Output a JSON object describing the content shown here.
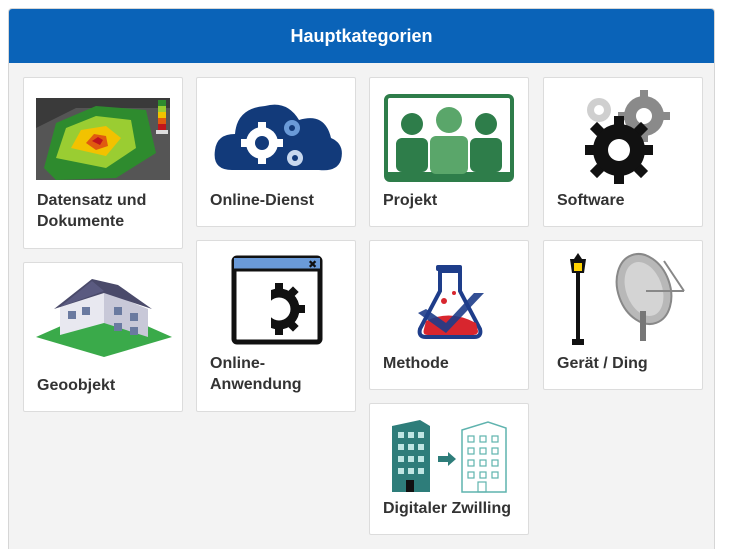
{
  "header": {
    "title": "Hauptkategorien"
  },
  "categories": [
    {
      "label": "Datensatz und Dokumente",
      "icon": "dataset-map-icon"
    },
    {
      "label": "Online-Dienst",
      "icon": "cloud-gears-icon"
    },
    {
      "label": "Projekt",
      "icon": "team-board-icon"
    },
    {
      "label": "Software",
      "icon": "gears-icon"
    },
    {
      "label": "Geoobjekt",
      "icon": "house-icon"
    },
    {
      "label": "Online-Anwendung",
      "icon": "app-window-gear-icon"
    },
    {
      "label": "Methode",
      "icon": "flask-icon"
    },
    {
      "label": "Gerät / Ding",
      "icon": "lamp-and-dish-icon"
    },
    {
      "label": "Digitaler Zwilling",
      "icon": "building-twin-icon"
    }
  ],
  "colors": {
    "header": "#0a63b8",
    "panel": "#f3f3f3",
    "card": "#ffffff",
    "text": "#333333"
  }
}
